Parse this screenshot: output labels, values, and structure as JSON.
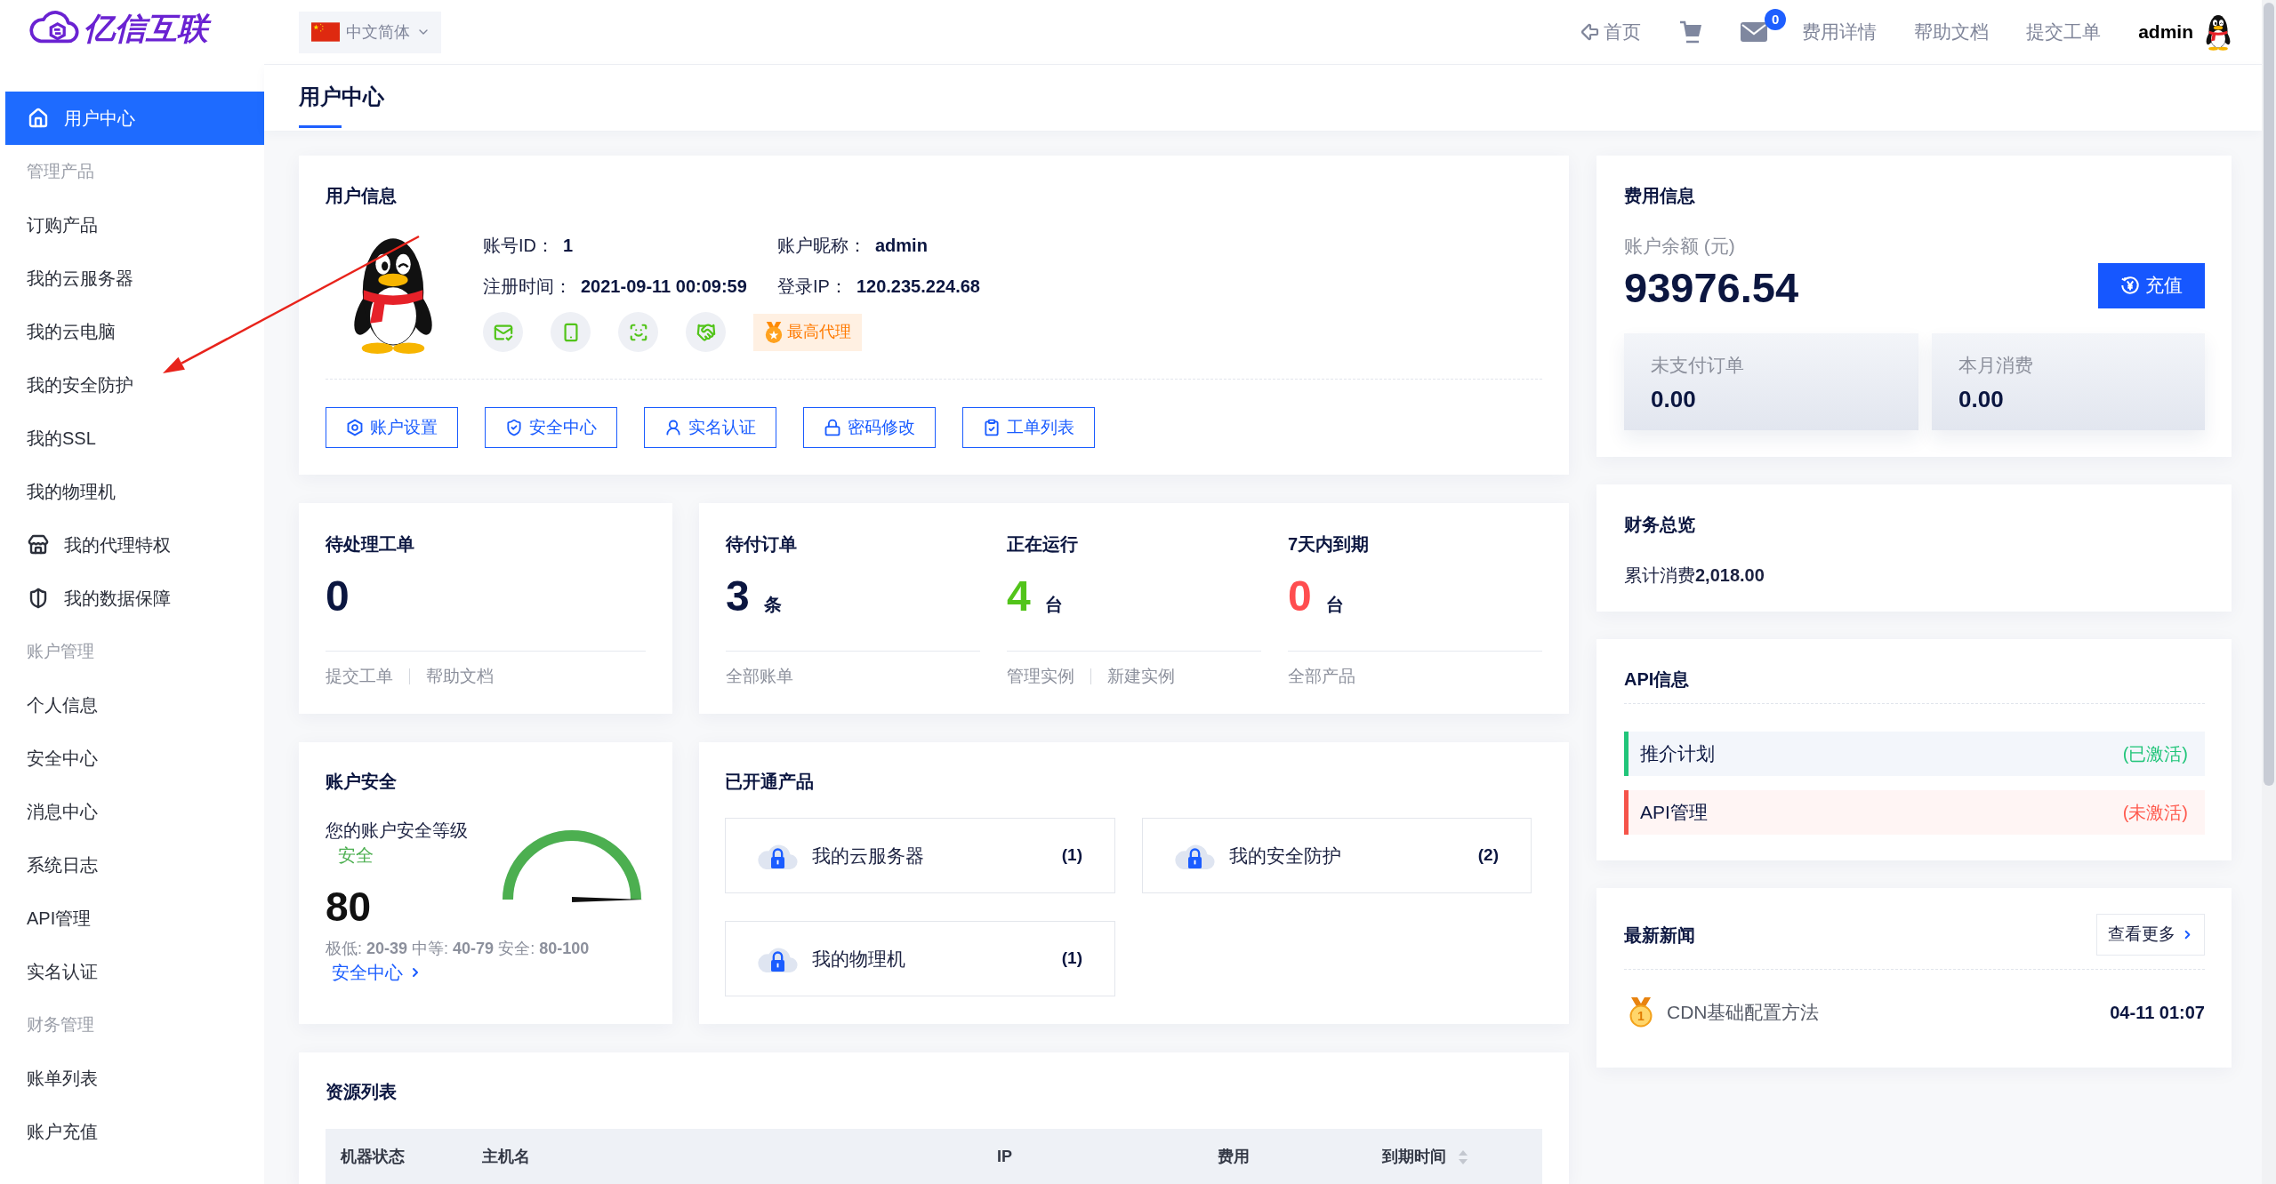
{
  "logo": {
    "text": "亿信互联"
  },
  "language": {
    "label": "中文简体"
  },
  "header": {
    "home": "首页",
    "mail_badge": "0",
    "links": [
      "费用详情",
      "帮助文档",
      "提交工单"
    ],
    "user": "admin"
  },
  "sidebar": {
    "items": [
      {
        "kind": "link",
        "label": "用户中心",
        "selected": true
      },
      {
        "kind": "section",
        "label": "管理产品"
      },
      {
        "kind": "link",
        "label": "订购产品",
        "selected": false
      },
      {
        "kind": "link",
        "label": "我的云服务器",
        "selected": false
      },
      {
        "kind": "link",
        "label": "我的云电脑",
        "selected": false
      },
      {
        "kind": "link",
        "label": "我的安全防护",
        "selected": false
      },
      {
        "kind": "link",
        "label": "我的SSL",
        "selected": false
      },
      {
        "kind": "link",
        "label": "我的物理机",
        "selected": false
      },
      {
        "kind": "link",
        "label": "我的代理特权",
        "selected": false
      },
      {
        "kind": "link",
        "label": "我的数据保障",
        "selected": false
      },
      {
        "kind": "section",
        "label": "账户管理"
      },
      {
        "kind": "link",
        "label": "个人信息",
        "selected": false
      },
      {
        "kind": "link",
        "label": "安全中心",
        "selected": false
      },
      {
        "kind": "link",
        "label": "消息中心",
        "selected": false
      },
      {
        "kind": "link",
        "label": "系统日志",
        "selected": false
      },
      {
        "kind": "link",
        "label": "API管理",
        "selected": false
      },
      {
        "kind": "link",
        "label": "实名认证",
        "selected": false
      },
      {
        "kind": "section",
        "label": "财务管理"
      },
      {
        "kind": "link",
        "label": "账单列表",
        "selected": false
      },
      {
        "kind": "link",
        "label": "账户充值",
        "selected": false
      }
    ]
  },
  "page_tab": {
    "label": "用户中心",
    "selected": true
  },
  "user_info": {
    "title": "用户信息",
    "fields": [
      {
        "label": "账号ID：",
        "value": "1"
      },
      {
        "label": "账户昵称：",
        "value": "admin"
      },
      {
        "label": "注册时间：",
        "value": "2021-09-11 00:09:59"
      },
      {
        "label": "登录IP：",
        "value": "120.235.224.68"
      }
    ],
    "verify_icons": [
      {
        "verified": true
      },
      {
        "verified": true
      },
      {
        "verified": true
      },
      {
        "verified": true
      }
    ],
    "badge": "最高代理",
    "buttons": [
      "账户设置",
      "安全中心",
      "实名认证",
      "密码修改",
      "工单列表"
    ]
  },
  "tickets": {
    "title": "待处理工单",
    "value": "0",
    "links": [
      "提交工单",
      "帮助文档"
    ]
  },
  "overview": [
    {
      "title": "待付订单",
      "value": "3",
      "unit": "条",
      "color": "#0b1640",
      "links": [
        "全部账单"
      ]
    },
    {
      "title": "正在运行",
      "value": "4",
      "unit": "台",
      "color": "#52c41a",
      "links": [
        "管理实例",
        "新建实例"
      ]
    },
    {
      "title": "7天内到期",
      "value": "0",
      "unit": "台",
      "color": "#ff4d4f",
      "links": [
        "全部产品"
      ]
    }
  ],
  "security": {
    "title": "账户安全",
    "label": "您的账户安全等级",
    "status": "安全",
    "score": "80",
    "legend": "极低: **20-39** 中等: **40-79** 安全: **80-100**",
    "link": "安全中心",
    "gauge": {
      "level": 1
    }
  },
  "products": {
    "title": "已开通产品",
    "items": [
      {
        "name": "我的云服务器",
        "count": "(1)"
      },
      {
        "name": "我的安全防护",
        "count": "(2)"
      },
      {
        "name": "我的物理机",
        "count": "(1)"
      }
    ]
  },
  "resources": {
    "title": "资源列表",
    "columns": [
      {
        "label": "机器状态",
        "sortable": false
      },
      {
        "label": "主机名",
        "sortable": false
      },
      {
        "label": "IP",
        "sortable": false
      },
      {
        "label": "费用",
        "sortable": false
      },
      {
        "label": "到期时间",
        "sortable": true
      }
    ]
  },
  "fees": {
    "title": "费用信息",
    "balance_label": "账户余额 (元)",
    "balance": "93976.54",
    "recharge": "充值",
    "tiles": [
      {
        "label": "未支付订单",
        "value": "0.00"
      },
      {
        "label": "本月消费",
        "value": "0.00"
      }
    ]
  },
  "finance": {
    "title": "财务总览",
    "total": "累计消费**2,018.00**"
  },
  "api": {
    "title": "API信息",
    "items": [
      {
        "name": "推介计划",
        "status": "(已激活)",
        "active": true
      },
      {
        "name": "API管理",
        "status": "(未激活)",
        "active": false
      }
    ]
  },
  "news": {
    "title": "最新新闻",
    "more": "查看更多",
    "items": [
      {
        "rank": "1",
        "title": "CDN基础配置方法",
        "time": "04-11 01:07"
      }
    ]
  }
}
